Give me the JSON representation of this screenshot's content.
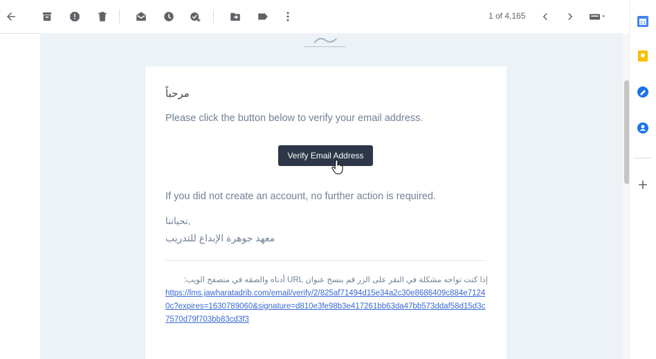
{
  "toolbar": {
    "pager_text": "1 of 4,165"
  },
  "icons": {
    "back": "arrow-back-icon",
    "archive": "archive-icon",
    "spam": "report-spam-icon",
    "delete": "delete-icon",
    "mark_unread": "mark-unread-icon",
    "snooze": "snooze-icon",
    "add_task": "add-task-icon",
    "move_to": "move-to-icon",
    "label": "label-icon",
    "more": "more-vert-icon",
    "prev": "chevron-left-icon",
    "next": "chevron-right-icon",
    "input_tools": "keyboard-icon"
  },
  "email": {
    "greeting": "مرحباً",
    "intro": "Please click the button below to verify your email address.",
    "button_label": "Verify Email Address",
    "no_action": "If you did not create an account, no further action is required.",
    "signoff": "تحياتنا,",
    "sender_name": "معهد جوهرة الإبداع للتدريب",
    "subcopy_text": "إذا كنت تواجه مشكلة في النقر على الزر قم بنسخ عنوان URL أدناه والصقه في متصفح الويب:",
    "subcopy_link": "https://lms.jawharatadrib.com/email/verify/2/825af71494d15e34a2c30e8686409c884e71240c?expires=1630789060&signature=d810e3fe98b3e417261bb63da47bb573ddaf58d15d3c7570d79f703bb83cd3f3"
  },
  "side_panel": {
    "items": [
      "calendar-icon",
      "keep-icon",
      "tasks-icon",
      "contacts-icon",
      "add-icon"
    ]
  },
  "colors": {
    "button_bg": "#2d3748",
    "email_bg": "#edf2f7",
    "link": "#3869d4",
    "text": "#718096"
  }
}
